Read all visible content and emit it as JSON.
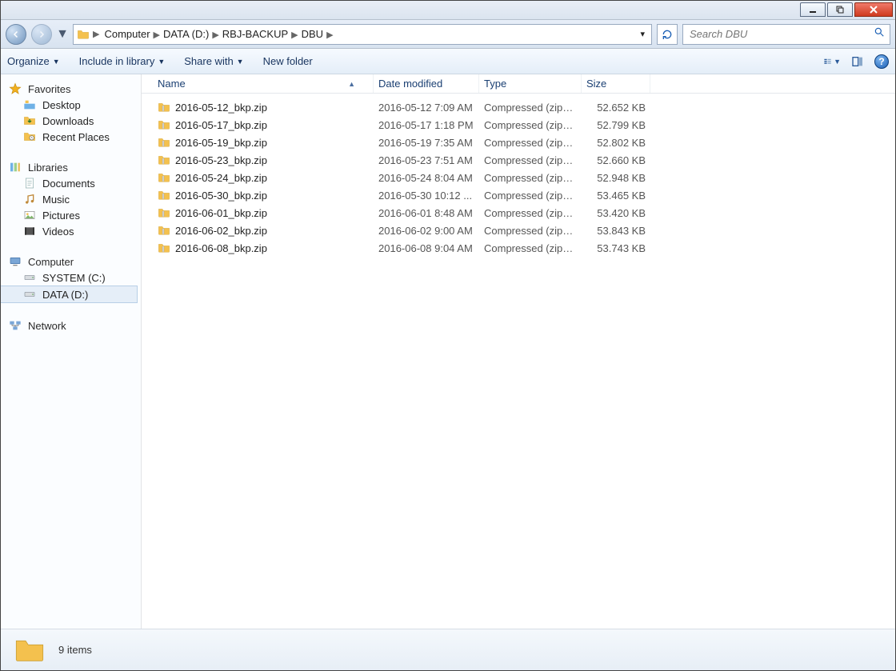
{
  "titlebar": {
    "close": "X"
  },
  "breadcrumbs": {
    "items": [
      "Computer",
      "DATA (D:)",
      "RBJ-BACKUP",
      "DBU"
    ]
  },
  "search": {
    "placeholder": "Search DBU"
  },
  "toolbar": {
    "organize": "Organize",
    "include": "Include in library",
    "share": "Share with",
    "newfolder": "New folder",
    "help": "?"
  },
  "nav": {
    "groups": [
      {
        "head": "Favorites",
        "icon": "star",
        "items": [
          {
            "label": "Desktop",
            "icon": "desktop"
          },
          {
            "label": "Downloads",
            "icon": "downloads"
          },
          {
            "label": "Recent Places",
            "icon": "recent"
          }
        ]
      },
      {
        "head": "Libraries",
        "icon": "libraries",
        "items": [
          {
            "label": "Documents",
            "icon": "doc"
          },
          {
            "label": "Music",
            "icon": "music"
          },
          {
            "label": "Pictures",
            "icon": "pic"
          },
          {
            "label": "Videos",
            "icon": "vid"
          }
        ]
      },
      {
        "head": "Computer",
        "icon": "computer",
        "items": [
          {
            "label": "SYSTEM (C:)",
            "icon": "drive"
          },
          {
            "label": "DATA (D:)",
            "icon": "drive",
            "selected": true
          }
        ]
      },
      {
        "head": "Network",
        "icon": "network",
        "items": []
      }
    ]
  },
  "columns": {
    "name": "Name",
    "date": "Date modified",
    "type": "Type",
    "size": "Size"
  },
  "files": [
    {
      "name": "2016-05-12_bkp.zip",
      "date": "2016-05-12 7:09 AM",
      "type": "Compressed (zipp...",
      "size": "52.652 KB"
    },
    {
      "name": "2016-05-17_bkp.zip",
      "date": "2016-05-17 1:18 PM",
      "type": "Compressed (zipp...",
      "size": "52.799 KB"
    },
    {
      "name": "2016-05-19_bkp.zip",
      "date": "2016-05-19 7:35 AM",
      "type": "Compressed (zipp...",
      "size": "52.802 KB"
    },
    {
      "name": "2016-05-23_bkp.zip",
      "date": "2016-05-23 7:51 AM",
      "type": "Compressed (zipp...",
      "size": "52.660 KB"
    },
    {
      "name": "2016-05-24_bkp.zip",
      "date": "2016-05-24 8:04 AM",
      "type": "Compressed (zipp...",
      "size": "52.948 KB"
    },
    {
      "name": "2016-05-30_bkp.zip",
      "date": "2016-05-30 10:12 ...",
      "type": "Compressed (zipp...",
      "size": "53.465 KB"
    },
    {
      "name": "2016-06-01_bkp.zip",
      "date": "2016-06-01 8:48 AM",
      "type": "Compressed (zipp...",
      "size": "53.420 KB"
    },
    {
      "name": "2016-06-02_bkp.zip",
      "date": "2016-06-02 9:00 AM",
      "type": "Compressed (zipp...",
      "size": "53.843 KB"
    },
    {
      "name": "2016-06-08_bkp.zip",
      "date": "2016-06-08 9:04 AM",
      "type": "Compressed (zipp...",
      "size": "53.743 KB"
    }
  ],
  "status": {
    "summary": "9 items"
  }
}
